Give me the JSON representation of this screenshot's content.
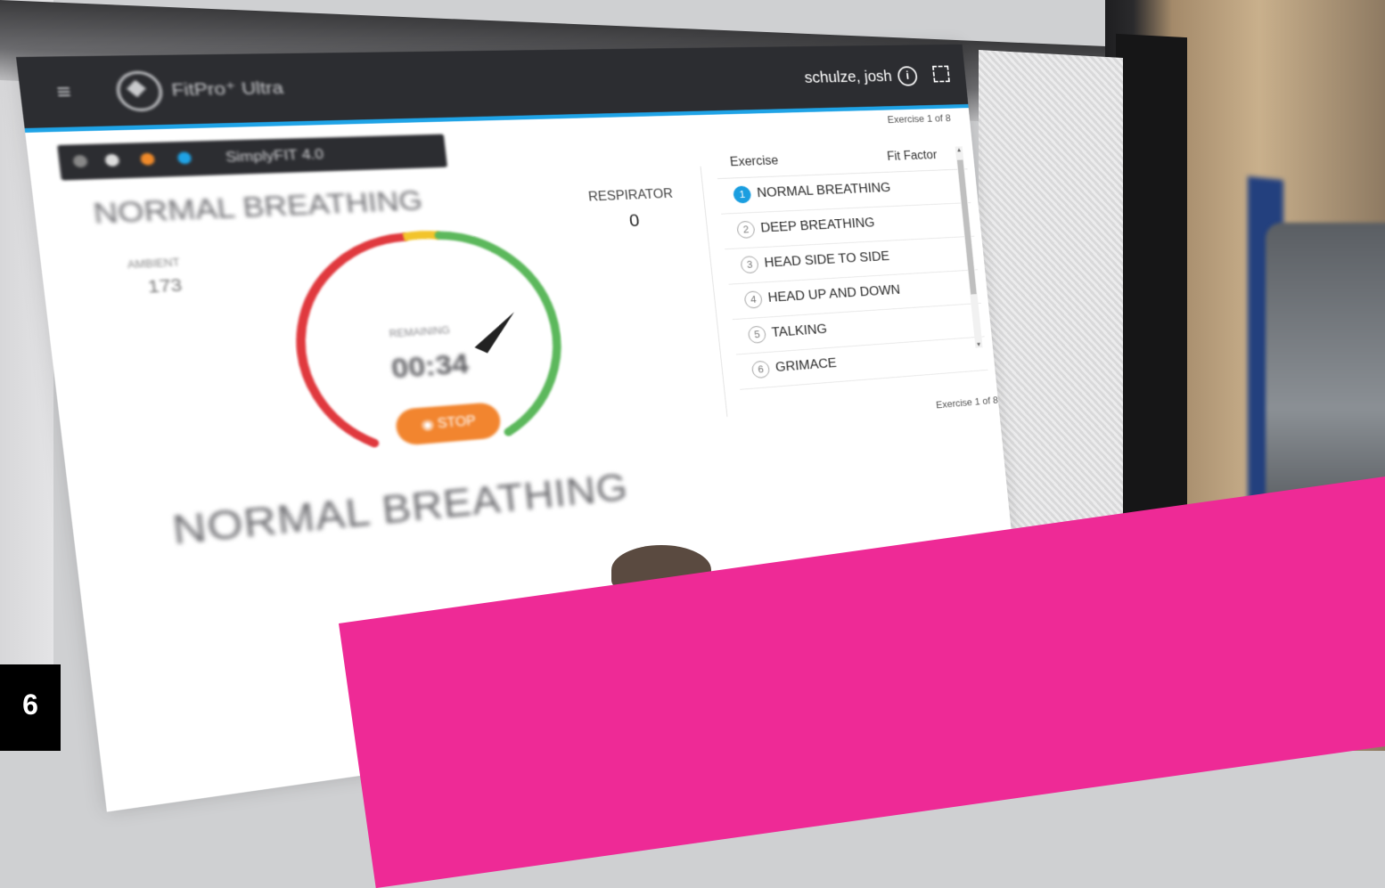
{
  "app": {
    "title": "FitPro⁺ Ultra",
    "user": "schulze, josh"
  },
  "toolbar": {
    "label": "SimplyFIT 4.0"
  },
  "test": {
    "exercise_name": "NORMAL BREATHING",
    "current_label": "AMBIENT",
    "current_value": "173",
    "remaining_label": "REMAINING",
    "remaining_value": "00:34",
    "stop_label": "STOP",
    "respirator_label": "RESPIRATOR",
    "respirator_value": "0",
    "exercise_counter": "Exercise 1 of 8",
    "gauge": {
      "colors": {
        "red": "#e0393e",
        "yellow": "#f2c42b",
        "green": "#5cb85c"
      }
    }
  },
  "exercise_list": {
    "headers": {
      "exercise": "Exercise",
      "fit_factor": "Fit Factor"
    },
    "items": [
      {
        "num": "1",
        "label": "NORMAL BREATHING",
        "active": true
      },
      {
        "num": "2",
        "label": "DEEP BREATHING"
      },
      {
        "num": "3",
        "label": "HEAD SIDE TO SIDE"
      },
      {
        "num": "4",
        "label": "HEAD UP AND DOWN"
      },
      {
        "num": "5",
        "label": "TALKING"
      },
      {
        "num": "6",
        "label": "GRIMACE"
      }
    ]
  },
  "demo": {
    "exercise_counter": "Exercise 1 of 8",
    "exercise_name": "NORMAL BREATHING"
  },
  "overlay": {
    "page_number": "6"
  },
  "colors": {
    "accent": "#1fa3e6",
    "header_bg": "#2c2d31",
    "stop_button": "#f2852f",
    "pink_band": "#ee2a96"
  }
}
